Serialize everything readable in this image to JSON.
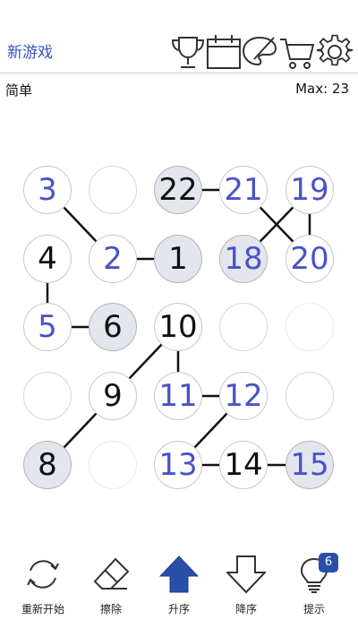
{
  "header": {
    "new_game_label": "新游戏",
    "icons": [
      "trophy-icon",
      "calendar-icon",
      "palette-icon",
      "cart-icon",
      "gear-icon"
    ]
  },
  "status": {
    "difficulty": "简单",
    "max_label": "Max: 23"
  },
  "colors": {
    "accent": "#3355bb",
    "number_blue": "#4a52c8",
    "given_fill": "#e3e6ec",
    "button_blue": "#2a4fa8"
  },
  "board": {
    "rows": 5,
    "cols": 5,
    "cells": [
      [
        {
          "value": "3",
          "style": "blue"
        },
        {
          "value": "",
          "style": "empty"
        },
        {
          "value": "22",
          "style": "given"
        },
        {
          "value": "21",
          "style": "blue"
        },
        {
          "value": "19",
          "style": "blue"
        }
      ],
      [
        {
          "value": "4",
          "style": "black"
        },
        {
          "value": "2",
          "style": "blue"
        },
        {
          "value": "1",
          "style": "given"
        },
        {
          "value": "18",
          "style": "given-blue"
        },
        {
          "value": "20",
          "style": "blue"
        }
      ],
      [
        {
          "value": "5",
          "style": "blue"
        },
        {
          "value": "6",
          "style": "given"
        },
        {
          "value": "10",
          "style": "black"
        },
        {
          "value": "",
          "style": "empty"
        },
        {
          "value": "",
          "style": "empty-faint"
        }
      ],
      [
        {
          "value": "",
          "style": "empty"
        },
        {
          "value": "9",
          "style": "black"
        },
        {
          "value": "11",
          "style": "blue"
        },
        {
          "value": "12",
          "style": "blue"
        },
        {
          "value": "",
          "style": "empty"
        }
      ],
      [
        {
          "value": "8",
          "style": "given"
        },
        {
          "value": "",
          "style": "empty-faint"
        },
        {
          "value": "13",
          "style": "blue"
        },
        {
          "value": "14",
          "style": "black"
        },
        {
          "value": "15",
          "style": "given-blue"
        }
      ]
    ],
    "links": [
      [
        [
          0,
          0
        ],
        [
          1,
          1
        ]
      ],
      [
        [
          1,
          1
        ],
        [
          1,
          2
        ]
      ],
      [
        [
          0,
          2
        ],
        [
          0,
          3
        ]
      ],
      [
        [
          0,
          3
        ],
        [
          1,
          4
        ]
      ],
      [
        [
          0,
          4
        ],
        [
          1,
          3
        ]
      ],
      [
        [
          0,
          4
        ],
        [
          1,
          4
        ]
      ],
      [
        [
          1,
          0
        ],
        [
          2,
          0
        ]
      ],
      [
        [
          2,
          0
        ],
        [
          2,
          1
        ]
      ],
      [
        [
          2,
          2
        ],
        [
          3,
          1
        ]
      ],
      [
        [
          2,
          2
        ],
        [
          3,
          2
        ]
      ],
      [
        [
          3,
          1
        ],
        [
          4,
          0
        ]
      ],
      [
        [
          3,
          2
        ],
        [
          3,
          3
        ]
      ],
      [
        [
          3,
          3
        ],
        [
          4,
          2
        ]
      ],
      [
        [
          4,
          2
        ],
        [
          4,
          3
        ]
      ],
      [
        [
          4,
          3
        ],
        [
          4,
          4
        ]
      ]
    ]
  },
  "toolbar": {
    "restart_label": "重新开始",
    "erase_label": "擦除",
    "ascending_label": "升序",
    "descending_label": "降序",
    "hint_label": "提示",
    "hint_count": "6"
  }
}
